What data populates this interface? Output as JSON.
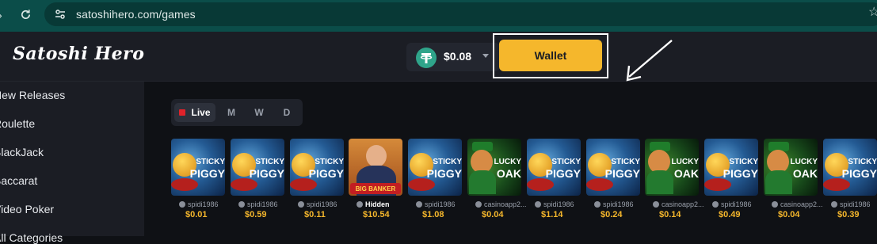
{
  "browser": {
    "url": "satoshihero.com/games",
    "back_icon": "chevron-right-icon",
    "reload_icon": "reload-icon",
    "site_settings_icon": "tune-icon",
    "bookmark_icon": "star-icon"
  },
  "header": {
    "logo": "Satoshi Hero",
    "balance": "$0.08",
    "currency_icon": "tether-icon",
    "wallet_label": "Wallet"
  },
  "sidebar": {
    "items": [
      {
        "label": "New Releases"
      },
      {
        "label": "Roulette"
      },
      {
        "label": "BlackJack"
      },
      {
        "label": "Baccarat"
      },
      {
        "label": "Video Poker"
      },
      {
        "label": "All Categories"
      }
    ]
  },
  "filters": {
    "tabs": [
      {
        "label": "Live"
      },
      {
        "label": "M"
      },
      {
        "label": "W"
      },
      {
        "label": "D"
      }
    ]
  },
  "live_bets": [
    {
      "title": "STICKY PIGGY",
      "user": "spidi1986",
      "amount": "$0.01"
    },
    {
      "title": "STICKY PIGGY",
      "user": "spidi1986",
      "amount": "$0.59"
    },
    {
      "title": "STICKY PIGGY",
      "user": "spidi1986",
      "amount": "$0.11"
    },
    {
      "title": "BIG BANKER",
      "user": "Hidden",
      "amount": "$10.54"
    },
    {
      "title": "STICKY PIGGY",
      "user": "spidi1986",
      "amount": "$1.08"
    },
    {
      "title": "LUCKY OAK",
      "user": "casinoapp2...",
      "amount": "$0.04"
    },
    {
      "title": "STICKY PIGGY",
      "user": "spidi1986",
      "amount": "$1.14"
    },
    {
      "title": "STICKY PIGGY",
      "user": "spidi1986",
      "amount": "$0.24"
    },
    {
      "title": "LUCKY OAK",
      "user": "casinoapp2...",
      "amount": "$0.14"
    },
    {
      "title": "STICKY PIGGY",
      "user": "spidi1986",
      "amount": "$0.49"
    },
    {
      "title": "LUCKY OAK",
      "user": "casinoapp2...",
      "amount": "$0.04"
    },
    {
      "title": "STICKY PIGGY",
      "user": "spidi1986",
      "amount": "$0.39"
    }
  ],
  "colors": {
    "accent": "#f5b72c",
    "live": "#e0222a",
    "browser_bar": "#0b4d49"
  }
}
